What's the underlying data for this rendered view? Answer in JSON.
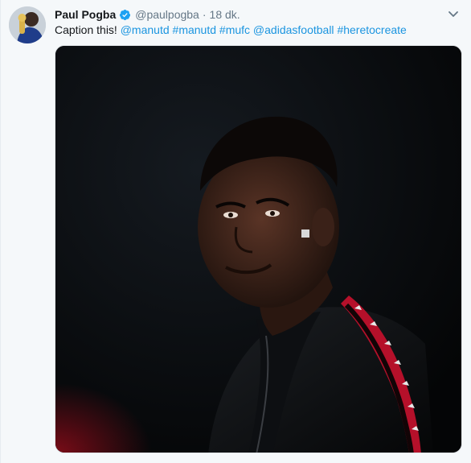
{
  "tweet": {
    "author_name": "Paul Pogba",
    "handle": "@paulpogba",
    "separator": "·",
    "time": "18 dk.",
    "text_prefix": "Caption this!",
    "entities": [
      "@manutd",
      "#manutd",
      "#mufc",
      "@adidasfootball",
      "#heretocreate"
    ]
  },
  "icons": {
    "verified": "verified-badge-icon",
    "caret": "chevron-down-icon"
  },
  "colors": {
    "link": "#1b95e0",
    "verified": "#1da1f2",
    "accent_stripe": "#b5102a"
  }
}
